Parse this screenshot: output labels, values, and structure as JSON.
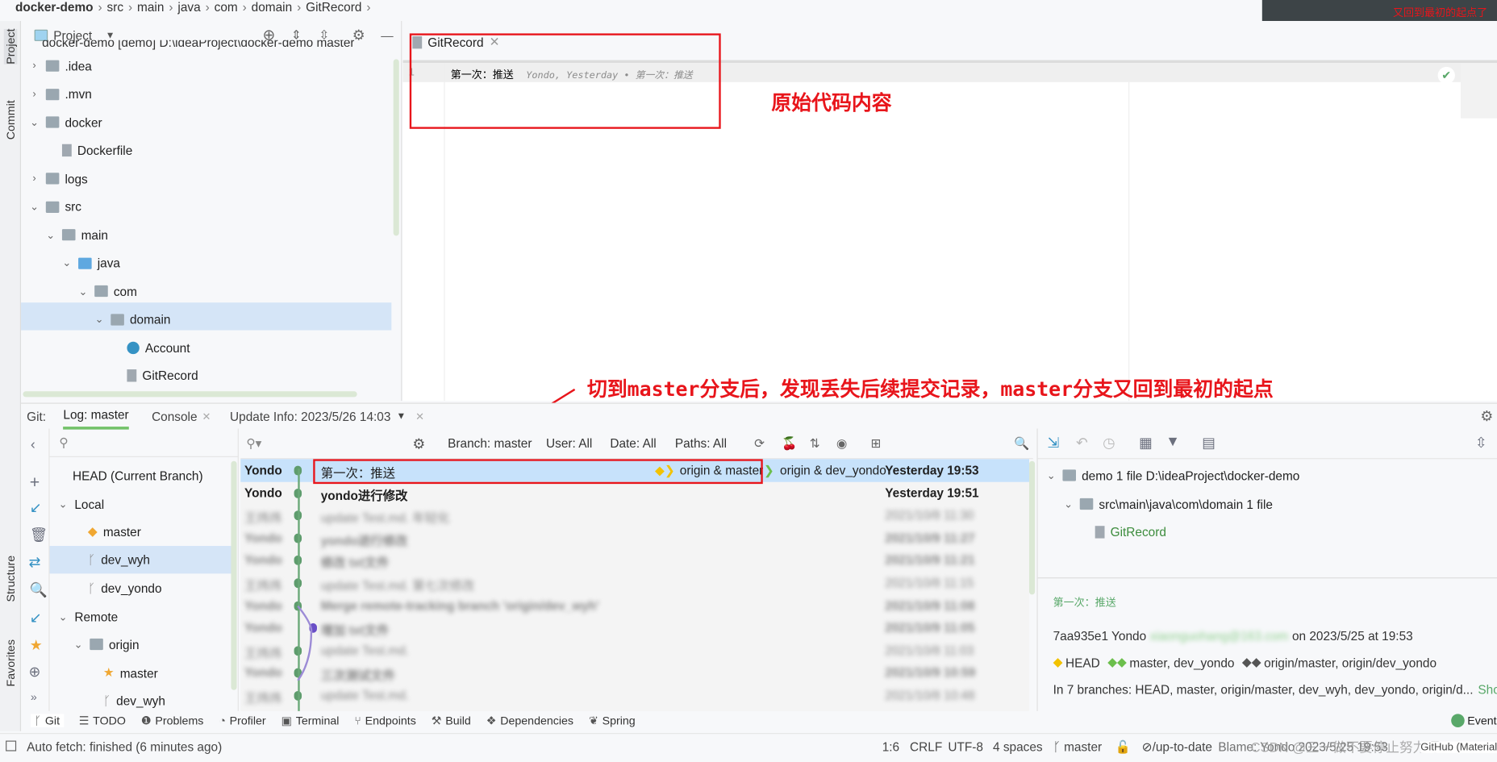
{
  "breadcrumb": [
    "docker-demo",
    "src",
    "main",
    "java",
    "com",
    "domain",
    "GitRecord"
  ],
  "popup_text": "又回到最初的起点了",
  "side_stripe": {
    "project": "Project",
    "commit": "Commit",
    "structure": "Structure",
    "favorites": "Favorites"
  },
  "project_panel": {
    "title": "Project",
    "root": "docker-demo [demo]  D:\\ideaProject\\docker-demo master",
    "tree": [
      {
        "label": ".idea",
        "depth": 1,
        "open": false,
        "type": "folder"
      },
      {
        "label": ".mvn",
        "depth": 1,
        "open": false,
        "type": "folder"
      },
      {
        "label": "docker",
        "depth": 1,
        "open": true,
        "type": "folder"
      },
      {
        "label": "Dockerfile",
        "depth": 2,
        "type": "file"
      },
      {
        "label": "logs",
        "depth": 1,
        "open": false,
        "type": "folder"
      },
      {
        "label": "src",
        "depth": 1,
        "open": true,
        "type": "folder"
      },
      {
        "label": "main",
        "depth": 2,
        "open": true,
        "type": "folder"
      },
      {
        "label": "java",
        "depth": 3,
        "open": true,
        "type": "folder-blue"
      },
      {
        "label": "com",
        "depth": 4,
        "open": true,
        "type": "folder"
      },
      {
        "label": "domain",
        "depth": 5,
        "open": true,
        "type": "folder",
        "selected": true
      },
      {
        "label": "Account",
        "depth": 6,
        "type": "class"
      },
      {
        "label": "GitRecord",
        "depth": 6,
        "type": "file"
      }
    ]
  },
  "editor": {
    "tab": "GitRecord",
    "line_number": "1",
    "code": "第一次：推送",
    "blame": "Yondo, Yesterday • 第一次：推送"
  },
  "annotations": {
    "code": "原始代码内容",
    "master": "切到master分支后，发现丢失后续提交记录，master分支又回到最初的起点"
  },
  "git": {
    "label": "Git:",
    "tabs": [
      "Log: master",
      "Console",
      "Update Info: 2023/5/26 14:03"
    ],
    "filters": {
      "branch": "Branch: master",
      "user": "User: All",
      "date": "Date: All",
      "paths": "Paths: All"
    },
    "branches": {
      "head": "HEAD (Current Branch)",
      "local": "Local",
      "local_items": [
        "master",
        "dev_wyh",
        "dev_yondo"
      ],
      "remote": "Remote",
      "origin": "origin",
      "remote_items": [
        "master",
        "dev_wyh"
      ]
    },
    "commits": [
      {
        "author": "Yondo",
        "msg": "第一次：推送",
        "refs1": "origin & master",
        "refs2": "origin & dev_yondo",
        "date": "Yesterday 19:53",
        "selected": true
      },
      {
        "author": "Yondo",
        "msg": "yondo进行修改",
        "date": "Yesterday 19:51",
        "bold": true
      },
      {
        "author": "王炜炜",
        "msg": "update Test.md. 年轻化",
        "date": "2021/10/8 11:30",
        "blur": true
      },
      {
        "author": "Yondo",
        "msg": "yondo进行修改",
        "date": "2021/10/9 11:27",
        "blur": true,
        "bold": true
      },
      {
        "author": "Yondo",
        "msg": "修改 txt文件",
        "date": "2021/10/9 11:21",
        "blur": true,
        "bold": true
      },
      {
        "author": "王炜炜",
        "msg": "update Test.md. 第七次修改",
        "date": "2021/10/8 11:15",
        "blur": true
      },
      {
        "author": "Yondo",
        "msg": "Merge remote-tracking branch 'origin/dev_wyh'",
        "date": "2021/10/9 11:08",
        "blur": true,
        "bold": true
      },
      {
        "author": "Yondo",
        "msg": "增加 txt文件",
        "date": "2021/10/9 11:05",
        "blur": true,
        "bold": true
      },
      {
        "author": "王炜炜",
        "msg": "update Test.md.",
        "date": "2021/10/8 11:03",
        "blur": true
      },
      {
        "author": "Yondo",
        "msg": "三次测试文件",
        "date": "2021/10/9 10:59",
        "blur": true,
        "bold": true
      },
      {
        "author": "王炜炜",
        "msg": "update Test.md.",
        "date": "2021/10/8 10:48",
        "blur": true
      }
    ],
    "details": {
      "root": "demo  1 file  D:\\ideaProject\\docker-demo",
      "dir": "src\\main\\java\\com\\domain  1 file",
      "file": "GitRecord",
      "message": "第一次：推送",
      "hash_author": "7aa935e1 Yondo",
      "email": "xiaonguohang@163.com",
      "when": "on 2023/5/25 at 19:53",
      "head": "HEAD",
      "local_refs": "master,  dev_yondo",
      "remote_refs": "origin/master,  origin/dev_yondo",
      "branches": "In 7 branches: HEAD, master, origin/master, dev_wyh, dev_yondo, origin/d...",
      "show": "Show"
    }
  },
  "toolwindows": [
    "Git",
    "TODO",
    "Problems",
    "Profiler",
    "Terminal",
    "Endpoints",
    "Build",
    "Dependencies",
    "Spring"
  ],
  "event_log": "Event",
  "status": {
    "fetch": "Auto fetch: finished (6 minutes ago)",
    "pos": "1:6",
    "eol": "CRLF",
    "enc": "UTF-8",
    "indent": "4 spaces",
    "branch": "master",
    "uptodate": "⊘/up-to-date",
    "blame": "Blame: Yondo 2023/5/25 19:53",
    "theme": "GitHub (Material)",
    "watermark": "CSDN @三一做不要停止努力呀"
  },
  "colors": {
    "accent_green": "#59a869",
    "selection": "#c7e2fb",
    "annotation_red": "#e8151b"
  }
}
